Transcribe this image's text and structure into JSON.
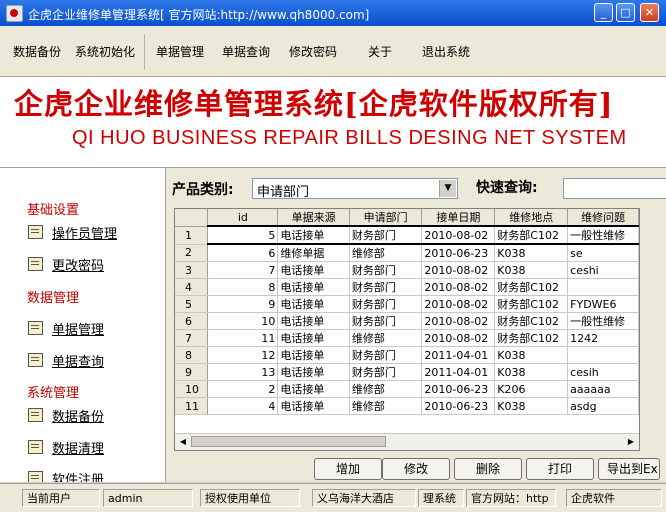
{
  "window": {
    "title": "企虎企业维修单管理系统[ 官方网站:http://www.qh8000.com]",
    "controls": [
      "minimize",
      "maximize",
      "close"
    ]
  },
  "menu": {
    "items": [
      "数据备份",
      "系统初始化",
      "单据管理",
      "单据查询",
      "修改密码",
      "关于",
      "退出系统"
    ]
  },
  "banner": {
    "title_cn": "企虎企业维修单管理系统[企虎软件版权所有]",
    "title_en": "QI HUO BUSINESS REPAIR BILLS DESING NET SYSTEM"
  },
  "sidebar": {
    "sections": [
      {
        "title": "基础设置",
        "items": [
          "操作员管理",
          "更改密码"
        ]
      },
      {
        "title": "数据管理",
        "items": [
          "单据管理",
          "单据查询"
        ]
      },
      {
        "title": "系统管理",
        "items": [
          "数据备份",
          "数据清理",
          "软件注册"
        ]
      }
    ]
  },
  "filter": {
    "category_label": "产品类别:",
    "category_value": "申请部门",
    "quick_search_label": "快速查询:",
    "quick_search_value": ""
  },
  "grid": {
    "columns": [
      "id",
      "单据来源",
      "申请部门",
      "接单日期",
      "维修地点",
      "维修问题"
    ],
    "rows": [
      [
        "1",
        "5",
        "电话接单",
        "财务部门",
        "2010-08-02",
        "财务部C102",
        "一般性维修"
      ],
      [
        "2",
        "6",
        "维修单据",
        "维修部",
        "2010-06-23",
        "K038",
        "se"
      ],
      [
        "3",
        "7",
        "电话接单",
        "财务部门",
        "2010-08-02",
        "K038",
        "ceshi"
      ],
      [
        "4",
        "8",
        "电话接单",
        "财务部门",
        "2010-08-02",
        "财务部C102",
        ""
      ],
      [
        "5",
        "9",
        "电话接单",
        "财务部门",
        "2010-08-02",
        "财务部C102",
        "FYDWE6"
      ],
      [
        "6",
        "10",
        "电话接单",
        "财务部门",
        "2010-08-02",
        "财务部C102",
        "一般性维修"
      ],
      [
        "7",
        "11",
        "电话接单",
        "维修部",
        "2010-08-02",
        "财务部C102",
        "1242"
      ],
      [
        "8",
        "12",
        "电话接单",
        "财务部门",
        "2011-04-01",
        "K038",
        ""
      ],
      [
        "9",
        "13",
        "电话接单",
        "财务部门",
        "2011-04-01",
        "K038",
        "cesih"
      ],
      [
        "10",
        "2",
        "电话接单",
        "维修部",
        "2010-06-23",
        "K206",
        "aaaaaa"
      ],
      [
        "11",
        "4",
        "电话接单",
        "维修部",
        "2010-06-23",
        "K038",
        "asdg"
      ]
    ],
    "selected_row": 1
  },
  "actions": [
    "增加",
    "修改",
    "删除",
    "打印",
    "导出到Ex"
  ],
  "status": {
    "current_user_label": "当前用户",
    "current_user": "admin",
    "license_label": "授权使用单位",
    "license_unit": "义乌海洋大酒店",
    "system_fragment": "理系统",
    "website_label": "官方网站：http",
    "software_label": "企虎软件"
  }
}
